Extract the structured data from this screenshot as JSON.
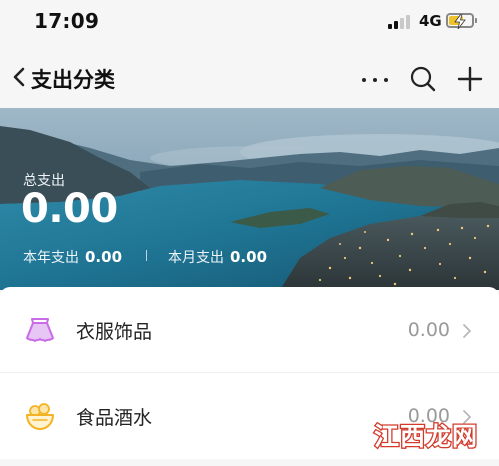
{
  "status_bar": {
    "time": "17:09",
    "network": "4G"
  },
  "nav": {
    "title": "支出分类",
    "icons": [
      "back-chevron-icon",
      "more-dots-icon",
      "search-icon",
      "plus-icon"
    ]
  },
  "banner": {
    "label": "总支出",
    "amount": "0.00",
    "year_label": "本年支出",
    "year_value": "0.00",
    "month_label": "本月支出",
    "month_value": "0.00"
  },
  "categories": [
    {
      "name": "衣服饰品",
      "amount": "0.00",
      "icon": "clothing-skirt-icon",
      "color": "#c86ce8"
    },
    {
      "name": "食品酒水",
      "amount": "0.00",
      "icon": "food-basket-icon",
      "color": "#f3b324"
    }
  ],
  "watermark": {
    "text": "江西龙网"
  },
  "colors": {
    "background": "#f6f6f6",
    "list_bg": "#ffffff",
    "amount_gray": "#9a9a9a"
  }
}
